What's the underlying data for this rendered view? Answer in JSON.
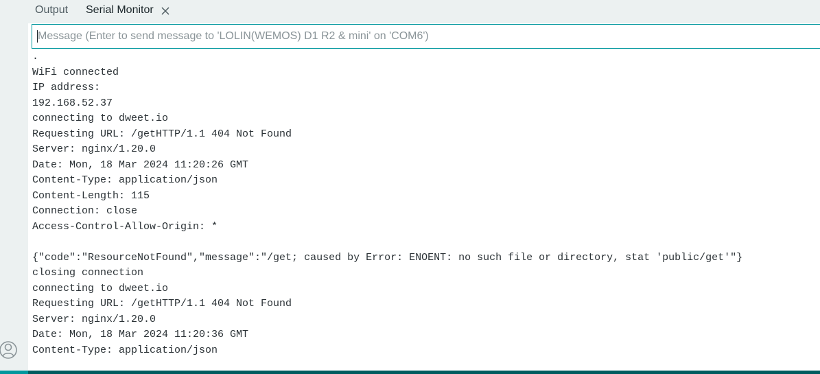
{
  "tabs": {
    "output": "Output",
    "serial_monitor": "Serial Monitor"
  },
  "message_input": {
    "placeholder": "Message (Enter to send message to 'LOLIN(WEMOS) D1 R2 & mini' on 'COM6')",
    "value": ""
  },
  "log": {
    "lines": [
      ".",
      "WiFi connected",
      "IP address:",
      "192.168.52.37",
      "connecting to dweet.io",
      "Requesting URL: /getHTTP/1.1 404 Not Found",
      "Server: nginx/1.20.0",
      "Date: Mon, 18 Mar 2024 11:20:26 GMT",
      "Content-Type: application/json",
      "Content-Length: 115",
      "Connection: close",
      "Access-Control-Allow-Origin: *",
      "",
      "{\"code\":\"ResourceNotFound\",\"message\":\"/get; caused by Error: ENOENT: no such file or directory, stat 'public/get'\"}",
      "closing connection",
      "connecting to dweet.io",
      "Requesting URL: /getHTTP/1.1 404 Not Found",
      "Server: nginx/1.20.0",
      "Date: Mon, 18 Mar 2024 11:20:36 GMT",
      "Content-Type: application/json"
    ]
  },
  "colors": {
    "accent": "#00979d",
    "status_bar": "#005c5f",
    "panel_background": "#ecf1f1"
  },
  "icons": {
    "close": "close-icon",
    "account": "account-icon"
  }
}
